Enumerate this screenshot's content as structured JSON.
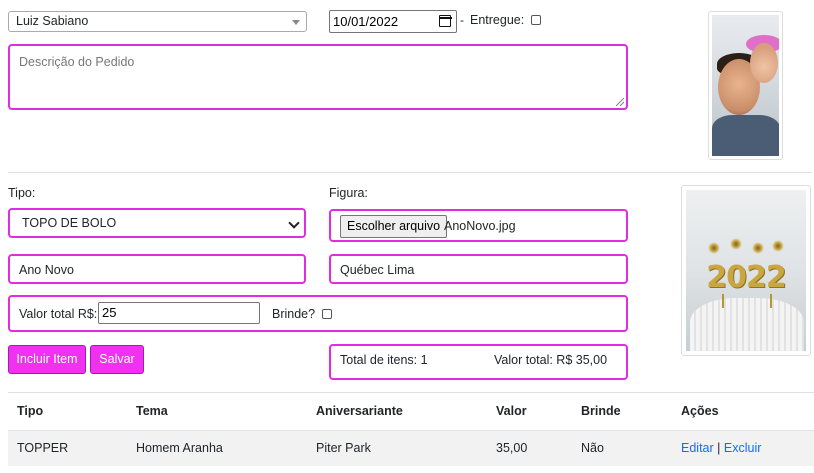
{
  "order": {
    "client": "Luiz Sabiano",
    "date": "10/01/2022",
    "date_separator": "-",
    "entregue_label": "Entregue:",
    "description_placeholder": "Descrição do Pedido"
  },
  "item_form": {
    "tipo_label": "Tipo:",
    "tipo_selected": "TOPO DE BOLO",
    "figura_label": "Figura:",
    "file_button": "Escolher arquivo",
    "file_name": "AnoNovo.jpg",
    "tema_value": "Ano Novo",
    "aniversariante_value": "Québec Lima",
    "valor_label": "Valor total R$:",
    "valor_value": "25",
    "brinde_label": "Brinde?",
    "preview_text": "2022"
  },
  "actions": {
    "incluir_label": "Incluir Item",
    "salvar_label": "Salvar"
  },
  "totals": {
    "itens_text": "Total de itens: 1",
    "valor_text": "Valor total: R$ 35,00"
  },
  "table": {
    "headers": [
      "Tipo",
      "Tema",
      "Aniversariante",
      "Valor",
      "Brinde",
      "Ações"
    ],
    "rows": [
      {
        "tipo": "TOPPER",
        "tema": "Homem Aranha",
        "aniversariante": "Piter Park",
        "valor": "35,00",
        "brinde": "Não",
        "edit": "Editar",
        "sep": "|",
        "delete": "Excluir"
      }
    ]
  },
  "colors": {
    "accent": "#e02de0",
    "button_bg": "#f230f2",
    "link": "#0d6efd"
  }
}
